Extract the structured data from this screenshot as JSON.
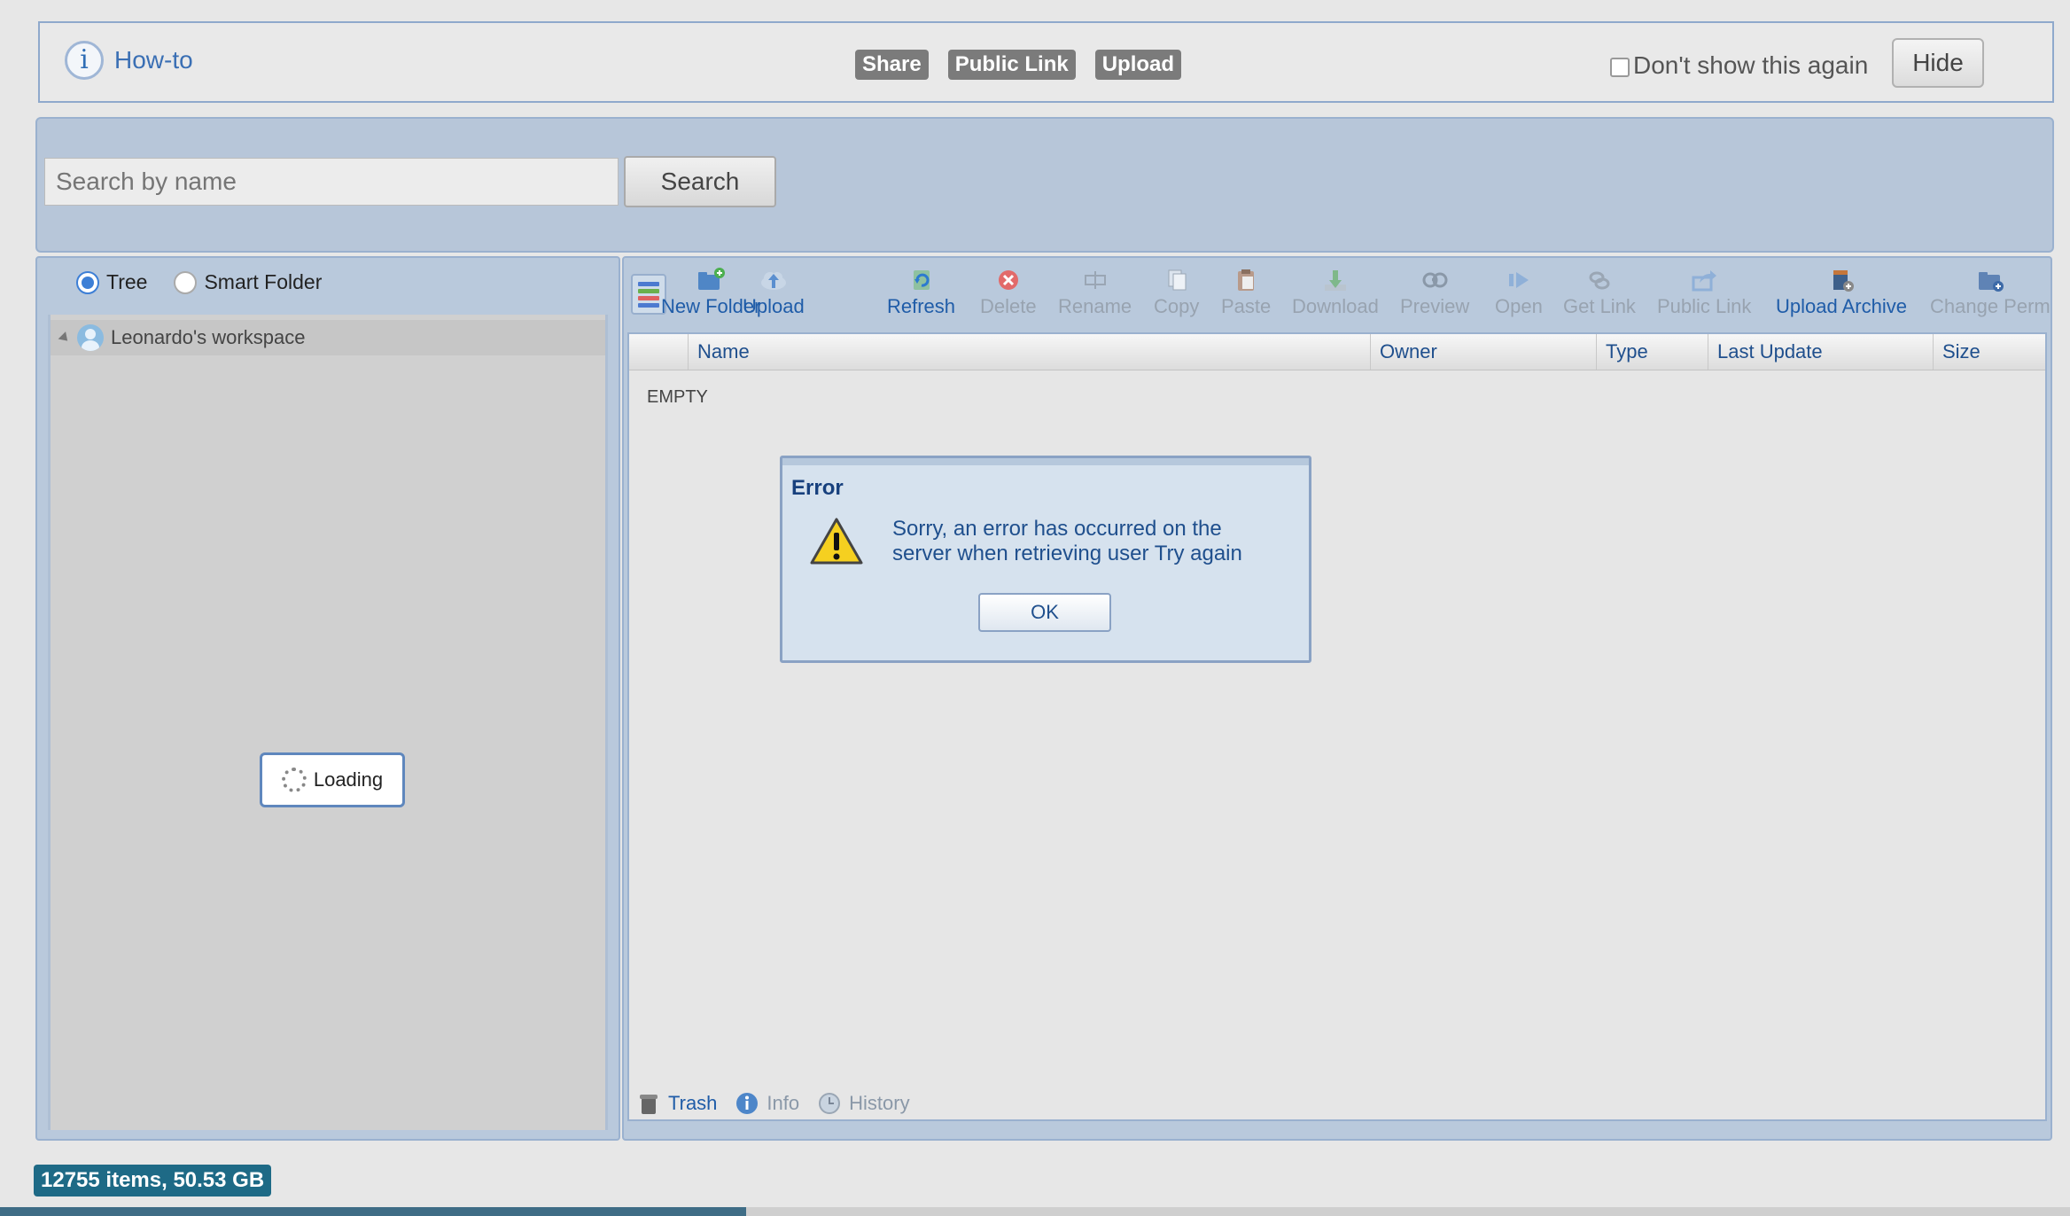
{
  "howto": {
    "label": "How-to"
  },
  "tutorial_badges": [
    "Share",
    "Public Link",
    "Upload"
  ],
  "dont_show": {
    "label": "Don't show this again"
  },
  "hide_button": {
    "label": "Hide"
  },
  "search": {
    "placeholder": "Search by name",
    "button_label": "Search"
  },
  "view_mode": {
    "tree_label": "Tree",
    "smart_folder_label": "Smart Folder",
    "selected": "Tree"
  },
  "tree": {
    "root_label": "Leonardo's workspace",
    "loading_label": "Loading"
  },
  "toolbar": {
    "buttons": [
      {
        "label": "New Folder",
        "enabled": true,
        "icon": "new-folder-icon"
      },
      {
        "label": "Upload",
        "enabled": true,
        "icon": "cloud-upload-icon"
      },
      {
        "label": "Refresh",
        "enabled": true,
        "icon": "refresh-icon"
      },
      {
        "label": "Delete",
        "enabled": false,
        "icon": "delete-icon"
      },
      {
        "label": "Rename",
        "enabled": false,
        "icon": "rename-icon"
      },
      {
        "label": "Copy",
        "enabled": false,
        "icon": "copy-icon"
      },
      {
        "label": "Paste",
        "enabled": false,
        "icon": "paste-icon"
      },
      {
        "label": "Download",
        "enabled": false,
        "icon": "download-icon"
      },
      {
        "label": "Preview",
        "enabled": false,
        "icon": "preview-icon"
      },
      {
        "label": "Open",
        "enabled": false,
        "icon": "open-icon"
      },
      {
        "label": "Get Link",
        "enabled": false,
        "icon": "link-icon"
      },
      {
        "label": "Public Link",
        "enabled": false,
        "icon": "share-icon"
      },
      {
        "label": "Upload Archive",
        "enabled": true,
        "icon": "archive-icon"
      },
      {
        "label": "Change Perm",
        "enabled": false,
        "icon": "folder-permissions-icon"
      }
    ]
  },
  "grid": {
    "columns": [
      "Name",
      "Owner",
      "Type",
      "Last Update",
      "Size"
    ],
    "empty_text": "EMPTY"
  },
  "bottom_tabs": {
    "trash": "Trash",
    "info": "Info",
    "history": "History"
  },
  "dialog": {
    "title": "Error",
    "message": "Sorry, an error has occurred on the server when retrieving user Try again",
    "ok_label": "OK"
  },
  "status": {
    "text": "12755 items, 50.53 GB"
  },
  "colors": {
    "accent": "#1f5ca8",
    "panel": "#b9c9dc",
    "status": "#1e6a86"
  }
}
